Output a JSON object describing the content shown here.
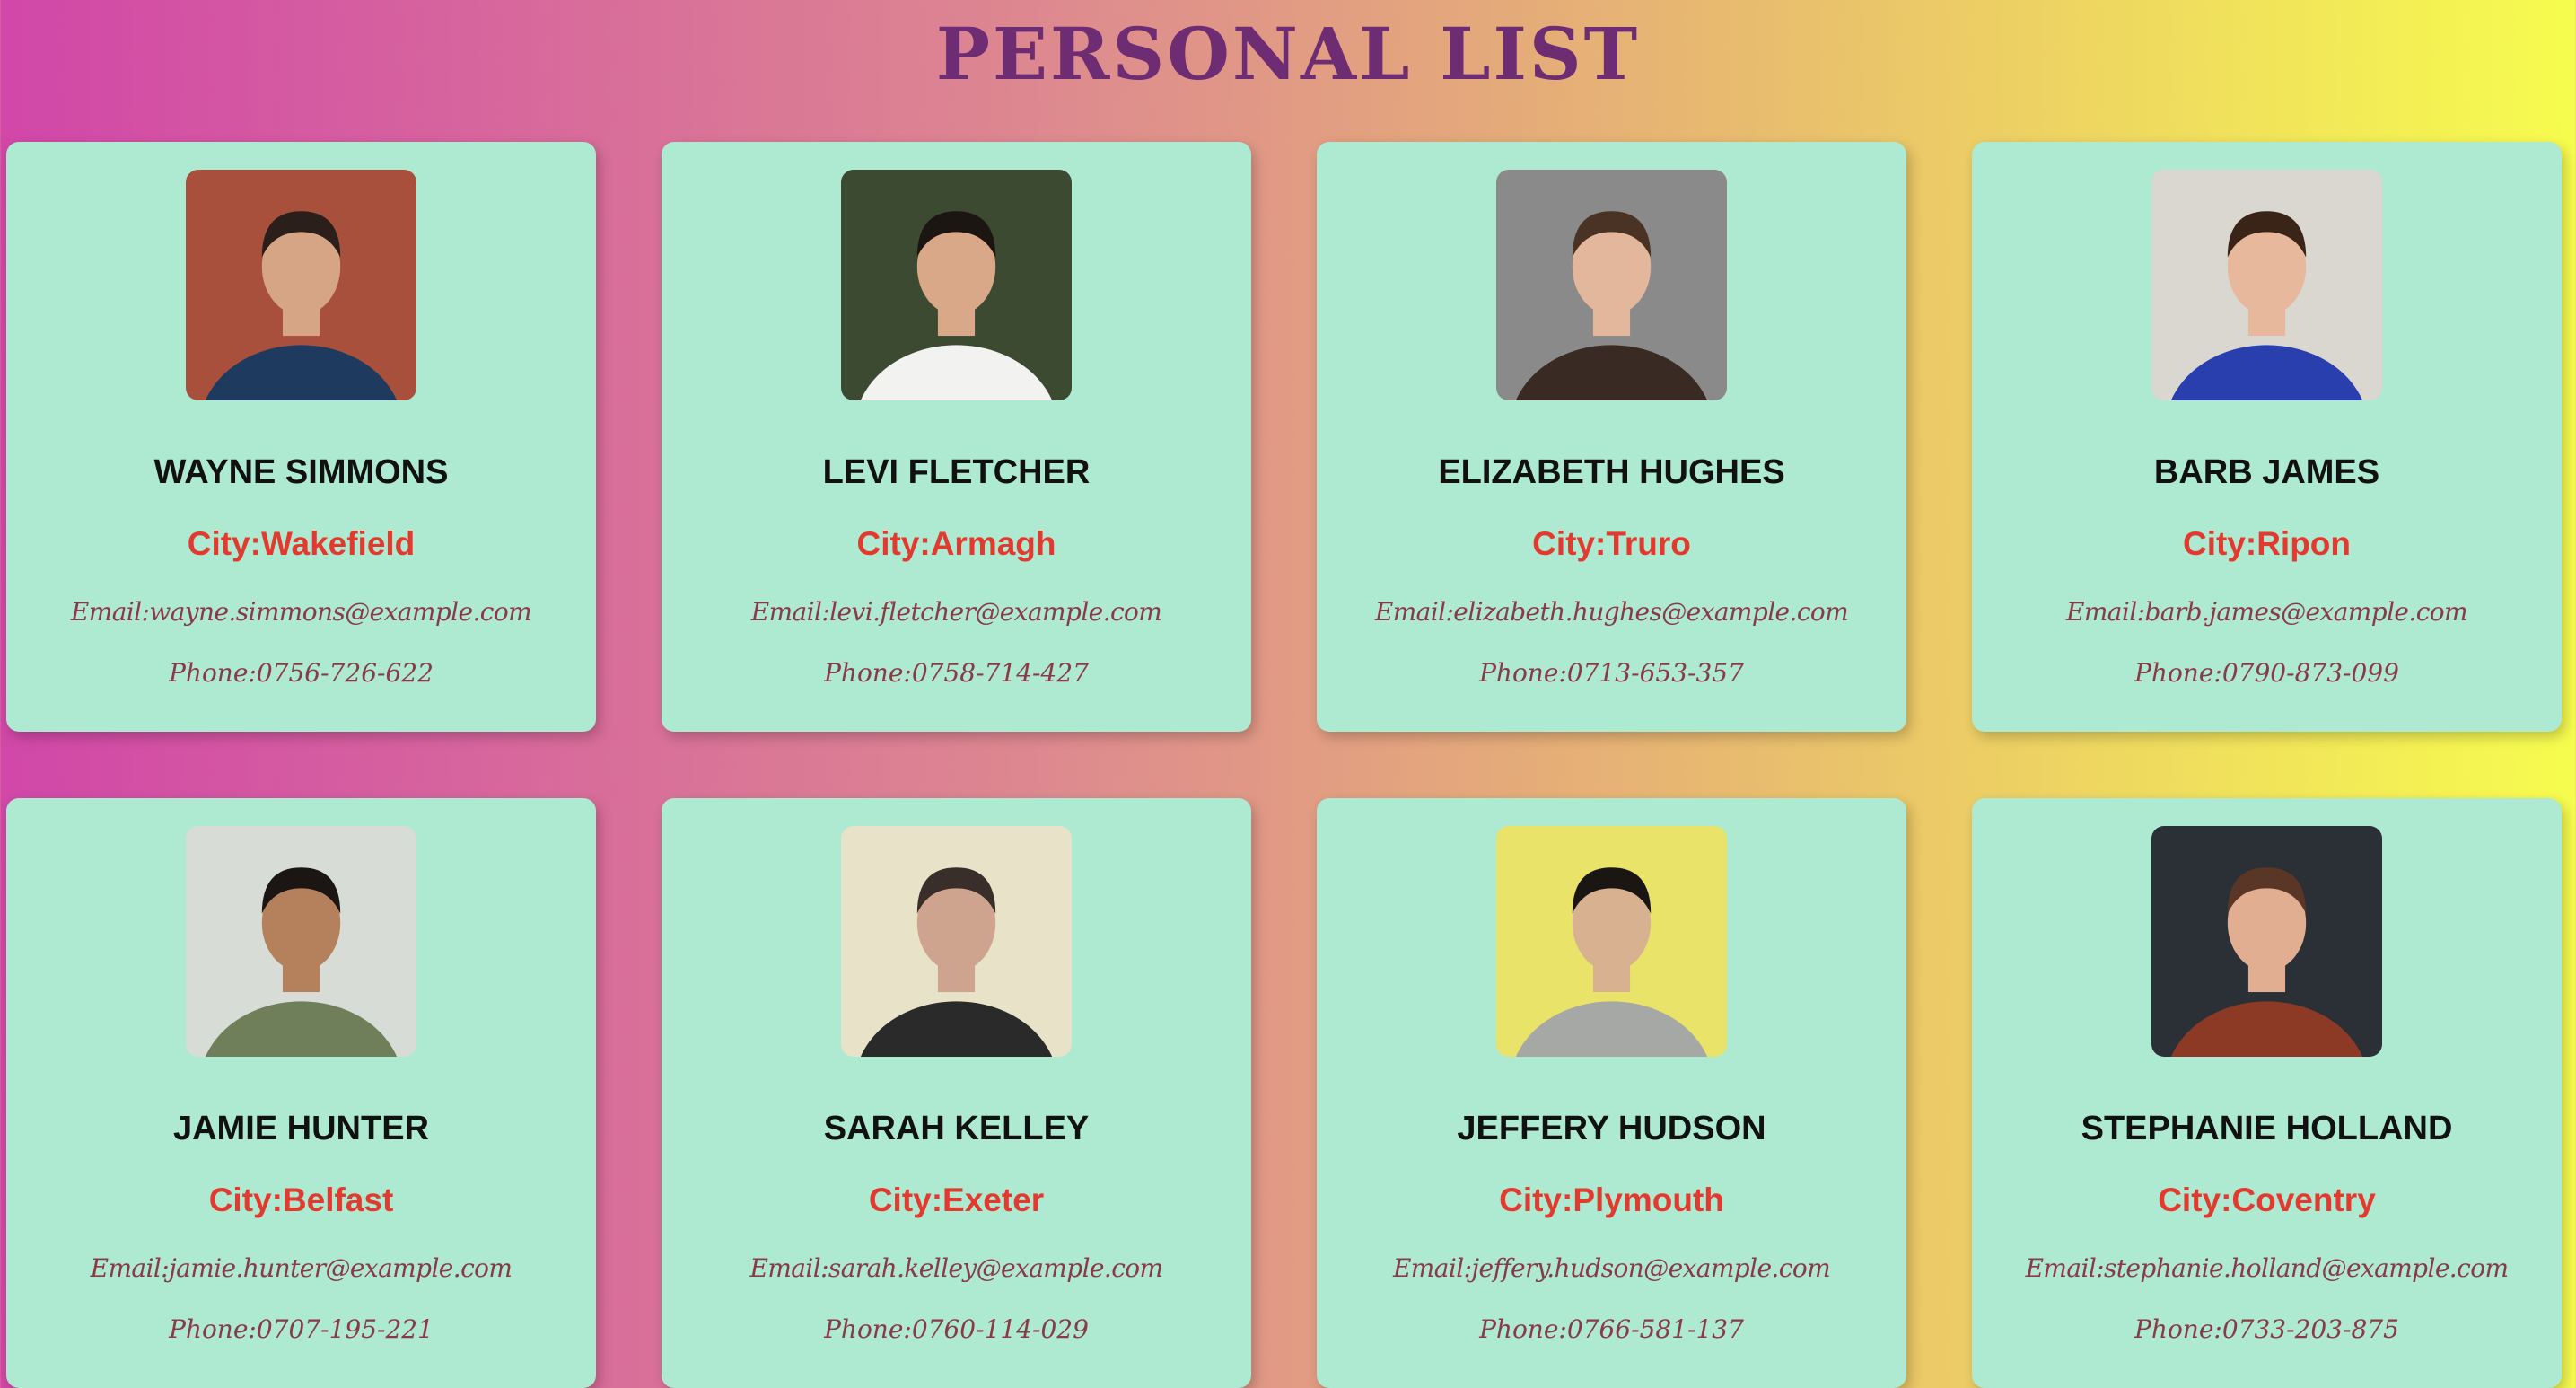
{
  "page": {
    "title": "PERSONAL LIST"
  },
  "people": [
    {
      "name": "WAYNE SIMMONS",
      "city": "City:Wakefield",
      "email": "Email:wayne.simmons@example.com",
      "phone": "Phone:0756-726-622",
      "photo_bg": "#a8503c",
      "photo_skin": "#d6a585",
      "photo_hair": "#2a1f1a",
      "photo_shirt": "#1e3a5f"
    },
    {
      "name": "LEVI FLETCHER",
      "city": "City:Armagh",
      "email": "Email:levi.fletcher@example.com",
      "phone": "Phone:0758-714-427",
      "photo_bg": "#3d4a32",
      "photo_skin": "#d9a888",
      "photo_hair": "#1c1612",
      "photo_shirt": "#f2f2f0"
    },
    {
      "name": "ELIZABETH HUGHES",
      "city": "City:Truro",
      "email": "Email:elizabeth.hughes@example.com",
      "phone": "Phone:0713-653-357",
      "photo_bg": "#8a8a8a",
      "photo_skin": "#e2b79c",
      "photo_hair": "#4a3224",
      "photo_shirt": "#3a2a24"
    },
    {
      "name": "BARB JAMES",
      "city": "City:Ripon",
      "email": "Email:barb.james@example.com",
      "phone": "Phone:0790-873-099",
      "photo_bg": "#d9d7cf",
      "photo_skin": "#e8b89d",
      "photo_hair": "#3a2418",
      "photo_shirt": "#2a3fae"
    },
    {
      "name": "JAMIE HUNTER",
      "city": "City:Belfast",
      "email": "Email:jamie.hunter@example.com",
      "phone": "Phone:0707-195-221",
      "photo_bg": "#d8dcd6",
      "photo_skin": "#b5805c",
      "photo_hair": "#1b1613",
      "photo_shirt": "#6e7f5a"
    },
    {
      "name": "SARAH KELLEY",
      "city": "City:Exeter",
      "email": "Email:sarah.kelley@example.com",
      "phone": "Phone:0760-114-029",
      "photo_bg": "#e8e2c8",
      "photo_skin": "#cfa48e",
      "photo_hair": "#3a2e2a",
      "photo_shirt": "#2a2a2a"
    },
    {
      "name": "JEFFERY HUDSON",
      "city": "City:Plymouth",
      "email": "Email:jeffery.hudson@example.com",
      "phone": "Phone:0766-581-137",
      "photo_bg": "#eae36a",
      "photo_skin": "#d8b191",
      "photo_hair": "#1a1614",
      "photo_shirt": "#a6a8a6"
    },
    {
      "name": "STEPHANIE HOLLAND",
      "city": "City:Coventry",
      "email": "Email:stephanie.holland@example.com",
      "phone": "Phone:0733-203-875",
      "photo_bg": "#2a3036",
      "photo_skin": "#e2ae92",
      "photo_hair": "#5a3626",
      "photo_shirt": "#8c3a26"
    }
  ]
}
